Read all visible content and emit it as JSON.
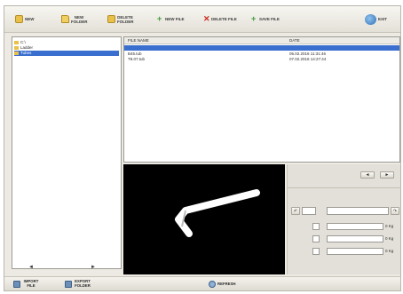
{
  "toolbar": {
    "new_label": "NEW",
    "new_folder_label": "NEW FOLDER",
    "delete_folder_label": "DELETE FOLDER",
    "new_file_label": "NEW FILE",
    "delete_file_label": "DELETE FILE",
    "save_file_label": "SAVE FILE",
    "exit_label": "EXIT"
  },
  "tree": {
    "items": [
      {
        "label": "C:\\"
      },
      {
        "label": "Ladder"
      },
      {
        "label": "Tubes"
      }
    ],
    "nav_left": "◄",
    "nav_right": "►"
  },
  "filelist": {
    "columns": [
      "FILE NAME",
      "DATE"
    ],
    "rows": [
      {
        "name": "",
        "date": "",
        "selected": true
      },
      {
        "name": "B45.tub",
        "date": "05.02.2016 11:31:46"
      },
      {
        "name": "T8.07.tub",
        "date": "07.02.2016 14:27:44"
      }
    ]
  },
  "controls": {
    "prev": "◄",
    "next": "►",
    "rotate_left": "↶",
    "rotate_right": "↷",
    "unit_a": "0 Kg",
    "unit_b": "0 Kg",
    "unit_c": "0 Kg"
  },
  "bottombar": {
    "import_label": "IMPORT FILE",
    "export_label": "EXPORT FOLDER",
    "refresh_label": "REFRESH"
  },
  "colors": {
    "selection": "#3a6fd0",
    "preview_bg": "#000000",
    "tube": "#ffffff"
  }
}
